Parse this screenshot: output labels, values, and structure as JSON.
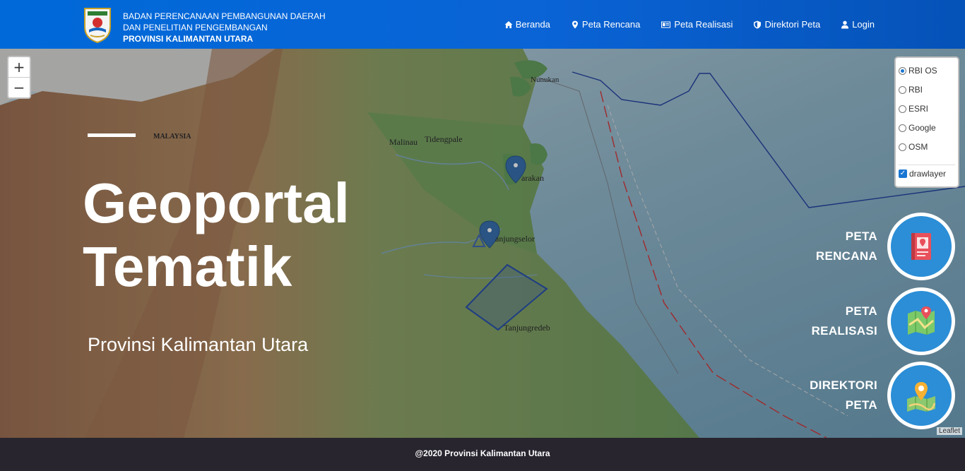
{
  "header": {
    "brand_line1": "BADAN PERENCANAAN PEMBANGUNAN DAERAH",
    "brand_line2": "DAN PENELITIAN PENGEMBANGAN",
    "brand_line3": "PROVINSI KALIMANTAN UTARA",
    "logo_icon": "kaltara-emblem-icon",
    "nav": [
      {
        "label": "Beranda",
        "icon": "home-icon"
      },
      {
        "label": "Peta Rencana",
        "icon": "map-marker-icon"
      },
      {
        "label": "Peta Realisasi",
        "icon": "id-card-icon"
      },
      {
        "label": "Direktori Peta",
        "icon": "shield-icon"
      },
      {
        "label": "Login",
        "icon": "user-icon"
      }
    ]
  },
  "map": {
    "zoom_in": "+",
    "zoom_out": "−",
    "place_labels": {
      "nunukan": "Nunukan",
      "malaysia": "MALAYSIA",
      "malinau": "Malinau",
      "tidengpale": "Tidengpale",
      "tarakan": "arakan",
      "tanjungselor": "anjungselor",
      "tanjungredeb": "Tanjungredeb"
    },
    "layers": {
      "base": [
        "RBI OS",
        "RBI",
        "ESRI",
        "Google",
        "OSM"
      ],
      "selected": "RBI OS",
      "overlay_label": "drawlayer",
      "overlay_checked": true
    },
    "attribution": "Leaflet"
  },
  "hero": {
    "title_line1": "Geoportal",
    "title_line2": "Tematik",
    "subtitle": "Provinsi Kalimantan Utara"
  },
  "side_links": [
    {
      "line1": "PETA",
      "line2": "RENCANA",
      "icon": "book-map-icon"
    },
    {
      "line1": "PETA",
      "line2": "REALISASI",
      "icon": "folded-map-pin-icon"
    },
    {
      "line1": "DIREKTORI",
      "line2": "PETA",
      "icon": "map-location-icon"
    }
  ],
  "footer": {
    "text": "@2020 Provinsi Kalimantan Utara"
  },
  "colors": {
    "navbar": "#0069d9",
    "footer": "#28252f",
    "accent": "#2b8ed6"
  }
}
